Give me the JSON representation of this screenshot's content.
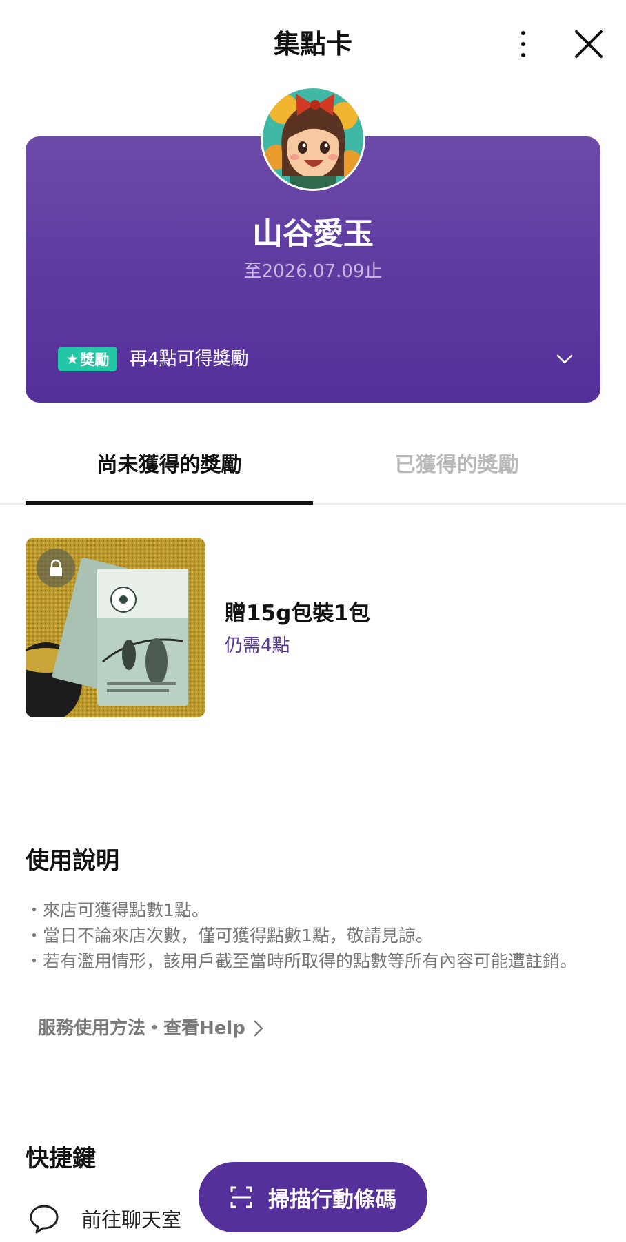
{
  "header": {
    "title": "集點卡",
    "more_icon": "more-vertical-icon",
    "close_icon": "close-icon"
  },
  "card": {
    "shop_name": "山谷愛玉",
    "expiry": "至2026.07.09止",
    "reward_badge": "獎勵",
    "reward_badge_icon": "star-icon",
    "reward_text": "再4點可得獎勵",
    "expand_icon": "chevron-down-icon"
  },
  "tabs": [
    {
      "label": "尚未獲得的獎勵",
      "active": true
    },
    {
      "label": "已獲得的獎勵",
      "active": false
    }
  ],
  "rewards": [
    {
      "title": "贈15g包裝1包",
      "need": "仍需4點",
      "lock_icon": "lock-icon"
    }
  ],
  "usage": {
    "heading": "使用說明",
    "items": [
      "・來店可獲得點數1點。",
      "・當日不論來店次數，僅可獲得點數1點，敬請見諒。",
      "・若有濫用情形，該用戶截至當時所取得的點數等所有內容可能遭註銷。"
    ],
    "help_link": "服務使用方法・查看Help"
  },
  "shortcuts": {
    "heading": "快捷鍵",
    "chat_label": "前往聊天室",
    "scan_label": "掃描行動條碼"
  },
  "colors": {
    "card_purple": "#5e3aa0",
    "badge_green": "#23c7a5",
    "button_purple": "#552f9a",
    "points_text": "#5a3a9e"
  }
}
